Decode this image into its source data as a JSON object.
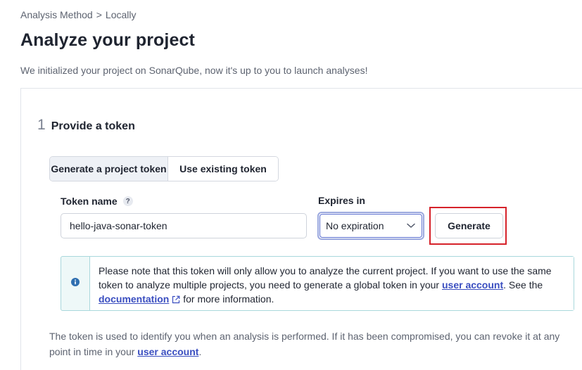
{
  "breadcrumb": {
    "items": [
      "Analysis Method",
      "Locally"
    ],
    "separator": ">"
  },
  "page": {
    "title": "Analyze your project",
    "subtitle": "We initialized your project on SonarQube, now it's up to you to launch analyses!"
  },
  "step": {
    "number": "1",
    "title": "Provide a token"
  },
  "token_toggle": {
    "options": [
      "Generate a project token",
      "Use existing token"
    ],
    "selected": "Generate a project token"
  },
  "form": {
    "token_name_label": "Token name",
    "help_icon": "?",
    "token_name_value": "hello-java-sonar-token",
    "expires_label": "Expires in",
    "expires_value": "No expiration",
    "generate_label": "Generate"
  },
  "info_box": {
    "icon": "info-icon",
    "text_1": "Please note that this token will only allow you to analyze the current project. If you want to use the same token to analyze multiple projects, you need to generate a global token in your ",
    "link_user_account": "user account",
    "text_2": ". See the ",
    "link_documentation": "documentation",
    "text_3": " for more information."
  },
  "footer_note": {
    "text_1": "The token is used to identify you when an analysis is performed. If it has been compromised, you can revoke it at any point in time in your ",
    "link_user_account": "user account",
    "text_2": "."
  },
  "colors": {
    "accent_link": "#3a4ec0",
    "highlight_border": "#d6222a",
    "info_border": "#a9d8dc",
    "info_bg": "#eef8f8",
    "info_icon": "#2f6fb0"
  }
}
